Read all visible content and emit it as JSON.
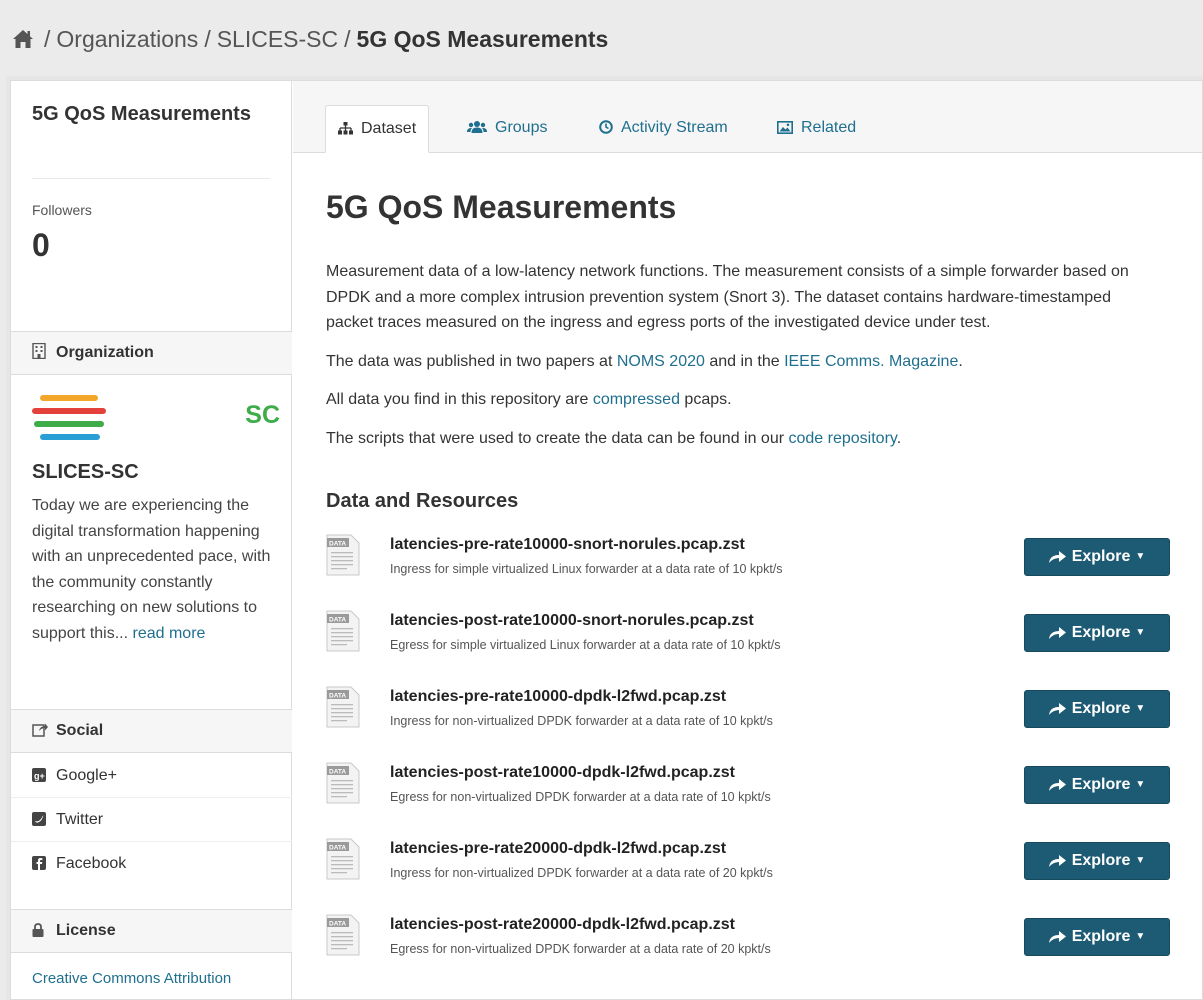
{
  "breadcrumb": {
    "home_icon": "home-icon",
    "items": [
      "Organizations",
      "SLICES-SC"
    ],
    "current": "5G QoS Measurements"
  },
  "sidebar": {
    "title": "5G QoS Measurements",
    "followers_label": "Followers",
    "followers_count": "0",
    "organization": {
      "heading": "Organization",
      "logo_text": "SC",
      "logo_colors": [
        "#f4a62a",
        "#e5413b",
        "#3eac49",
        "#2a9fd6"
      ],
      "name": "SLICES-SC",
      "description": "Today we are experiencing the digital transformation happening with an unprecedented pace, with the community constantly researching on new solutions to support this...",
      "read_more": "read more"
    },
    "social": {
      "heading": "Social",
      "items": [
        {
          "label": "Google+",
          "icon": "google-plus-icon"
        },
        {
          "label": "Twitter",
          "icon": "twitter-icon"
        },
        {
          "label": "Facebook",
          "icon": "facebook-icon"
        }
      ]
    },
    "license": {
      "heading": "License",
      "link": "Creative Commons Attribution"
    }
  },
  "tabs": [
    {
      "label": "Dataset",
      "icon": "sitemap-icon",
      "active": true
    },
    {
      "label": "Groups",
      "icon": "users-icon",
      "active": false
    },
    {
      "label": "Activity Stream",
      "icon": "clock-icon",
      "active": false
    },
    {
      "label": "Related",
      "icon": "picture-icon",
      "active": false
    }
  ],
  "main": {
    "title": "5G QoS Measurements",
    "p1": "Measurement data of a low-latency network functions. The measurement consists of a simple forwarder based on DPDK and a more complex intrusion prevention system (Snort 3). The dataset contains hardware-timestamped packet traces measured on the ingress and egress ports of the investigated device under test.",
    "p2_pre": "The data was published in two papers at ",
    "p2_link1": "NOMS 2020",
    "p2_mid": " and in the ",
    "p2_link2": "IEEE Comms. Magazine",
    "p2_post": ".",
    "p3_pre": "All data you find in this repository are ",
    "p3_link": "compressed",
    "p3_post": " pcaps.",
    "p4_pre": "The scripts that were used to create the data can be found in our ",
    "p4_link": "code repository",
    "p4_post": ".",
    "resources_heading": "Data and Resources",
    "explore_label": "Explore",
    "file_badge": "DATA",
    "resources": [
      {
        "name": "latencies-pre-rate10000-snort-norules.pcap.zst",
        "desc": "Ingress for simple virtualized Linux forwarder at a data rate of 10 kpkt/s"
      },
      {
        "name": "latencies-post-rate10000-snort-norules.pcap.zst",
        "desc": "Egress for simple virtualized Linux forwarder at a data rate of 10 kpkt/s"
      },
      {
        "name": "latencies-pre-rate10000-dpdk-l2fwd.pcap.zst",
        "desc": "Ingress for non-virtualized DPDK forwarder at a data rate of 10 kpkt/s"
      },
      {
        "name": "latencies-post-rate10000-dpdk-l2fwd.pcap.zst",
        "desc": "Egress for non-virtualized DPDK forwarder at a data rate of 10 kpkt/s"
      },
      {
        "name": "latencies-pre-rate20000-dpdk-l2fwd.pcap.zst",
        "desc": "Ingress for non-virtualized DPDK forwarder at a data rate of 20 kpkt/s"
      },
      {
        "name": "latencies-post-rate20000-dpdk-l2fwd.pcap.zst",
        "desc": "Egress for non-virtualized DPDK forwarder at a data rate of 20 kpkt/s"
      }
    ]
  }
}
